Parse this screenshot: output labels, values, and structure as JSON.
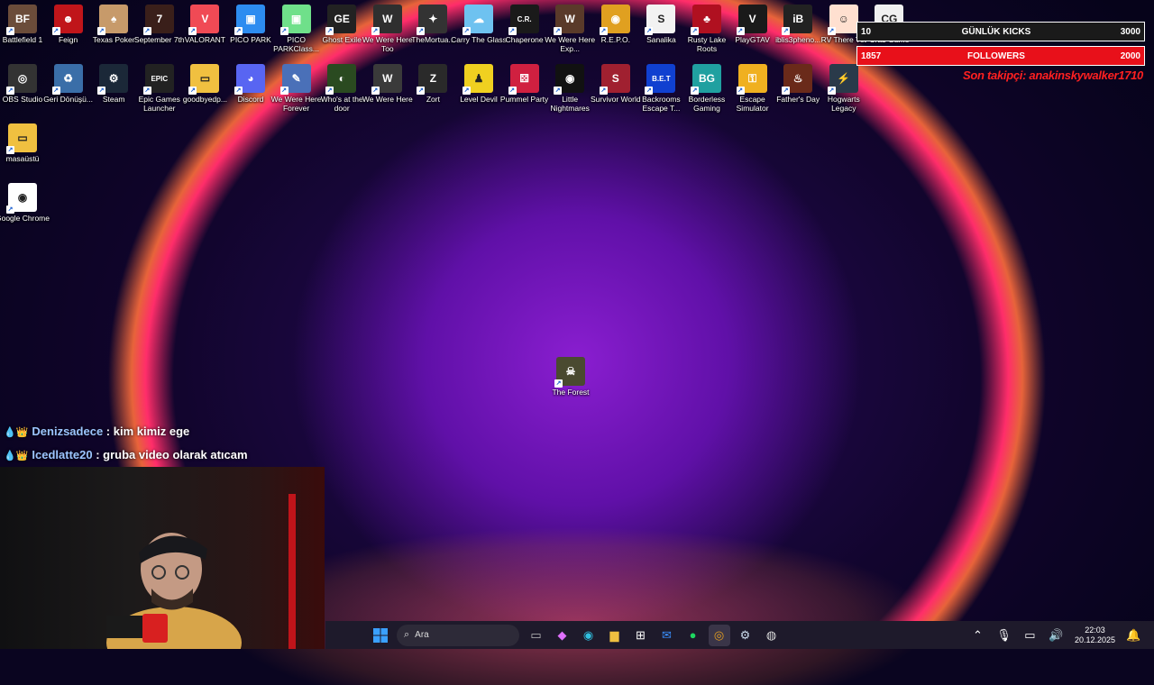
{
  "desktop": {
    "row1": [
      {
        "label": "Battlefield 1",
        "color": "#6b4c3a",
        "glyph": "BF"
      },
      {
        "label": "Feign",
        "color": "#c0151a",
        "glyph": "☻"
      },
      {
        "label": "Texas Poker",
        "color": "#c79a6a",
        "glyph": "♠"
      },
      {
        "label": "September 7th",
        "color": "#3a1f1a",
        "glyph": "7"
      },
      {
        "label": "VALORANT",
        "color": "#f04a55",
        "glyph": "V"
      },
      {
        "label": "PICO PARK",
        "color": "#2d8cf0",
        "glyph": "▣"
      },
      {
        "label": "PICO PARKClass...",
        "color": "#6fe08a",
        "glyph": "▣"
      },
      {
        "label": "Ghost Exile",
        "color": "#222",
        "glyph": "GE"
      },
      {
        "label": "We Were Here Too",
        "color": "#2f2f2f",
        "glyph": "W"
      },
      {
        "label": "TheMortua...",
        "color": "#333",
        "glyph": "✦"
      },
      {
        "label": "Carry The Glass",
        "color": "#6ec2f0",
        "glyph": "☁"
      },
      {
        "label": "Chaperone",
        "color": "#1a1a1a",
        "glyph": "C.R."
      },
      {
        "label": "We Were Here Exp...",
        "color": "#5a3a2a",
        "glyph": "W"
      },
      {
        "label": "R.E.P.O.",
        "color": "#e0a020",
        "glyph": "◉"
      },
      {
        "label": "Sanalika",
        "color": "#f2f2f2",
        "glyph": "S"
      },
      {
        "label": "Rusty Lake Roots",
        "color": "#b01020",
        "glyph": "♣"
      },
      {
        "label": "PlayGTAV",
        "color": "#1a1a1a",
        "glyph": "V"
      },
      {
        "label": "iblis3pheno...",
        "color": "#222",
        "glyph": "iB"
      },
      {
        "label": "RV There Yet",
        "color": "#ffe0d0",
        "glyph": "☺"
      },
      {
        "label": "Crab Game",
        "color": "#f0f0f0",
        "glyph": "CG"
      }
    ],
    "row2": [
      {
        "label": "OBS Studio",
        "color": "#333",
        "glyph": "◎"
      },
      {
        "label": "Geri Dönüşü...",
        "color": "#3a6ea8",
        "glyph": "♻"
      },
      {
        "label": "Steam",
        "color": "#1b2838",
        "glyph": "⚙"
      },
      {
        "label": "Epic Games Launcher",
        "color": "#222",
        "glyph": "EPIC"
      },
      {
        "label": "goodbyedp...",
        "color": "#f0c040",
        "glyph": "▭"
      },
      {
        "label": "Discord",
        "color": "#5865f2",
        "glyph": "◕"
      },
      {
        "label": "We Were Here Forever",
        "color": "#4a70b8",
        "glyph": "✎"
      },
      {
        "label": "Who's at the door",
        "color": "#2a4a20",
        "glyph": "◐"
      },
      {
        "label": "We Were Here",
        "color": "#3a3a3a",
        "glyph": "W"
      },
      {
        "label": "Zort",
        "color": "#2a2a2a",
        "glyph": "Z"
      },
      {
        "label": "Level Devil",
        "color": "#f0d020",
        "glyph": "♟"
      },
      {
        "label": "Pummel Party",
        "color": "#d02040",
        "glyph": "⚄"
      },
      {
        "label": "Little Nightmares",
        "color": "#111",
        "glyph": "◉"
      },
      {
        "label": "Survivor World",
        "color": "#a02030",
        "glyph": "S"
      },
      {
        "label": "Backrooms Escape T...",
        "color": "#1040d0",
        "glyph": "B.E.T"
      },
      {
        "label": "Borderless Gaming",
        "color": "#20a0a0",
        "glyph": "BG"
      },
      {
        "label": "Escape Simulator",
        "color": "#f0b020",
        "glyph": "⚿"
      },
      {
        "label": "Father's Day",
        "color": "#6a2a1a",
        "glyph": "♨"
      },
      {
        "label": "Hogwarts Legacy",
        "color": "#2a3a4a",
        "glyph": "⚡"
      }
    ],
    "col1": [
      {
        "label": "masaüstü",
        "color": "#f0c040",
        "glyph": "▭"
      },
      {
        "label": "Google Chrome",
        "color": "#ffffff",
        "glyph": "◉"
      }
    ],
    "center": {
      "label": "The Forest",
      "color": "#4a4a30",
      "glyph": "☠"
    }
  },
  "overlay": {
    "kicks": {
      "left": "10",
      "title": "GÜNLÜK KICKS",
      "right": "3000"
    },
    "followers": {
      "left": "1857",
      "title": "FOLLOWERS",
      "right": "2000"
    },
    "last_follower": "Son takipçi: anakinskywalker1710"
  },
  "chat": [
    {
      "user": "Denizsadece",
      "msg": ": kim kimiz ege"
    },
    {
      "user": "Icedlatte20",
      "msg": ": gruba video olarak atıcam"
    }
  ],
  "taskbar": {
    "search_placeholder": "Ara",
    "time": "22:03",
    "date": "20.12.2025"
  },
  "colors": {
    "overlay_red": "#e8101a",
    "overlay_bg": "#1a1a1a",
    "last_follower": "#ff2020"
  }
}
